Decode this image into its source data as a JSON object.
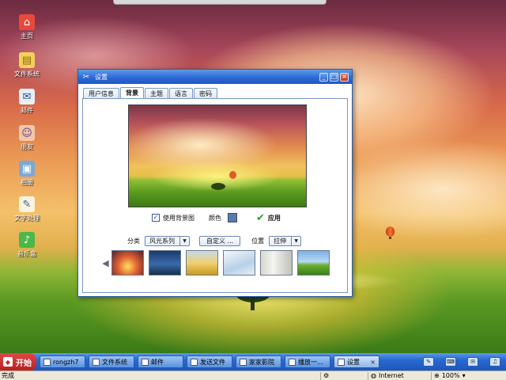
{
  "desktop": {
    "icons": [
      {
        "label": "主页",
        "glyph": "home-icon"
      },
      {
        "label": "文件系统",
        "glyph": "folder-icon"
      },
      {
        "label": "邮件",
        "glyph": "mail-icon"
      },
      {
        "label": "朋友",
        "glyph": "people-icon"
      },
      {
        "label": "相册",
        "glyph": "photo-icon"
      },
      {
        "label": "文字处理",
        "glyph": "document-icon"
      },
      {
        "label": "音乐盒",
        "glyph": "music-icon"
      }
    ]
  },
  "window": {
    "title": "设置",
    "controls": {
      "minimize": "_",
      "maximize": "□",
      "close": "×"
    },
    "tabs": [
      {
        "label": "用户信息",
        "active": false
      },
      {
        "label": "背景",
        "active": true
      },
      {
        "label": "主题",
        "active": false
      },
      {
        "label": "语言",
        "active": false
      },
      {
        "label": "密码",
        "active": false
      }
    ],
    "background_panel": {
      "use_background_label": "使用背景图",
      "use_background_checked": true,
      "color_label": "颜色",
      "color_value": "#5a7ab0",
      "apply_label": "应用",
      "category_label": "分类",
      "category_value": "风光系列",
      "custom_button": "自定义 ...",
      "position_label": "位置",
      "position_value": "拉伸"
    }
  },
  "taskbar": {
    "start_label": "开始",
    "tasks": [
      {
        "label": "rongzh7",
        "active": false
      },
      {
        "label": "文件系统",
        "active": false
      },
      {
        "label": "邮件",
        "active": false
      },
      {
        "label": "发送文件",
        "active": false
      },
      {
        "label": "家家影院",
        "active": false
      },
      {
        "label": "播放一...",
        "active": false
      },
      {
        "label": "设置",
        "active": true,
        "close": "×"
      }
    ]
  },
  "statusbar": {
    "status": "完成",
    "zone": "Internet",
    "zoom": "100%"
  }
}
